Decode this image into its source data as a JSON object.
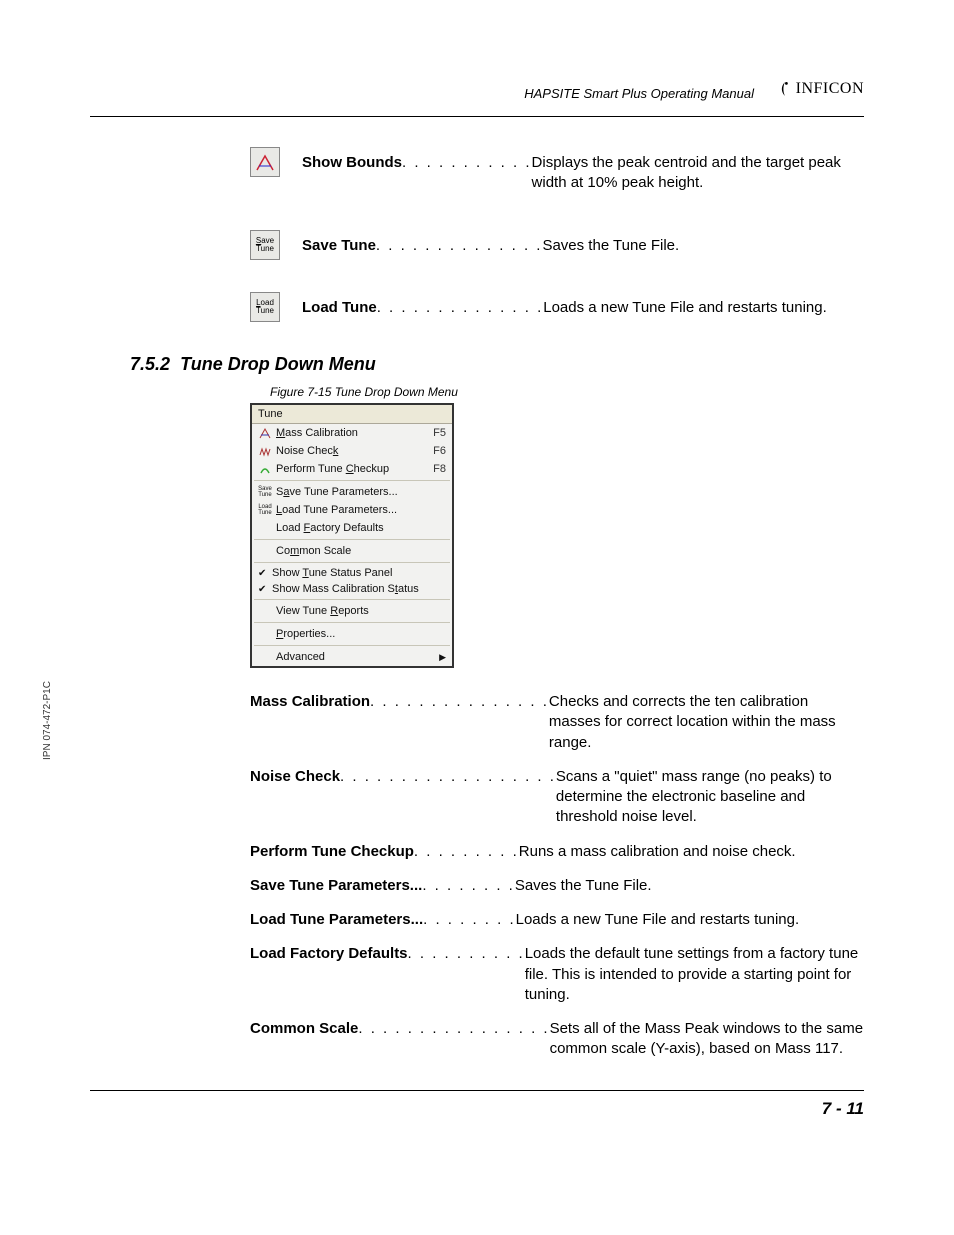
{
  "header": {
    "manual_title": "HAPSITE Smart Plus Operating Manual",
    "brand": "INFICON"
  },
  "icon_defs": [
    {
      "icon": "show-bounds",
      "label": "Show Bounds",
      "dots": " . . . . . . . . . . . ",
      "desc": "Displays the peak centroid and the target peak width at 10% peak height."
    },
    {
      "icon": "save-tune",
      "label": "Save Tune",
      "dots": " . . . . . . . . . . . . . . ",
      "desc": "Saves the Tune File."
    },
    {
      "icon": "load-tune",
      "label": "Load Tune",
      "dots": " . . . . . . . . . . . . . . ",
      "desc": "Loads a new Tune File and restarts tuning."
    }
  ],
  "section": {
    "number": "7.5.2",
    "title": "Tune Drop Down Menu"
  },
  "figure_caption": "Figure 7-15  Tune Drop Down Menu",
  "menu": {
    "header": "Tune",
    "groups": [
      [
        {
          "icon": "cal",
          "label_pre": "",
          "u": "M",
          "label_post": "ass Calibration",
          "shortcut": "F5"
        },
        {
          "icon": "noise",
          "label_pre": "Noise Chec",
          "u": "k",
          "label_post": "",
          "shortcut": "F6"
        },
        {
          "icon": "tune",
          "label_pre": "Perform Tune ",
          "u": "C",
          "label_post": "heckup",
          "shortcut": "F8"
        }
      ],
      [
        {
          "icon": "save",
          "label_pre": "S",
          "u": "a",
          "label_post": "ve Tune Parameters...",
          "shortcut": ""
        },
        {
          "icon": "load",
          "label_pre": "",
          "u": "L",
          "label_post": "oad Tune Parameters...",
          "shortcut": ""
        },
        {
          "icon": "",
          "label_pre": "Load ",
          "u": "F",
          "label_post": "actory Defaults",
          "shortcut": ""
        }
      ],
      [
        {
          "icon": "",
          "label_pre": "Co",
          "u": "m",
          "label_post": "mon Scale",
          "shortcut": ""
        }
      ],
      [
        {
          "check": true,
          "label_pre": "Show ",
          "u": "T",
          "label_post": "une Status Panel",
          "shortcut": ""
        },
        {
          "check": true,
          "label_pre": "Show Mass Calibration S",
          "u": "t",
          "label_post": "atus",
          "shortcut": ""
        }
      ],
      [
        {
          "icon": "",
          "label_pre": "View Tune ",
          "u": "R",
          "label_post": "eports",
          "shortcut": ""
        }
      ],
      [
        {
          "icon": "",
          "label_pre": "",
          "u": "P",
          "label_post": "roperties...",
          "shortcut": ""
        }
      ],
      [
        {
          "icon": "",
          "label_pre": "Advanced",
          "u": "",
          "label_post": "",
          "shortcut": "",
          "arrow": true
        }
      ]
    ]
  },
  "menu_defs": [
    {
      "label": "Mass Calibration",
      "dots": ". . . . . . . . . . . . . . . ",
      "desc": "Checks and corrects the ten calibration masses for correct location within the mass range."
    },
    {
      "label": "Noise Check",
      "dots": " . . . . . . . . . . . . . . . . . . ",
      "desc": "Scans a \"quiet\" mass range (no peaks) to determine the electronic baseline and threshold noise level."
    },
    {
      "label": "Perform Tune Checkup",
      "dots": " . . . . . . . . . ",
      "desc": "Runs a mass calibration and noise check."
    },
    {
      "label": "Save Tune Parameters...",
      "dots": " . . . . . . . . ",
      "desc": "Saves the Tune File."
    },
    {
      "label": "Load Tune Parameters...",
      "dots": " . . . . . . . . ",
      "desc": "Loads a new Tune File and restarts tuning."
    },
    {
      "label": "Load Factory Defaults",
      "dots": " . . . . . . . . . . ",
      "desc": "Loads the default tune settings from a factory tune file. This is intended to provide a starting point for tuning."
    },
    {
      "label": "Common Scale",
      "dots": " . . . . . . . . . . . . . . . . ",
      "desc": "Sets all of the Mass Peak windows to the same common scale (Y-axis), based on Mass 117."
    }
  ],
  "side_text": "IPN 074-472-P1C",
  "page_number": "7 - 11"
}
